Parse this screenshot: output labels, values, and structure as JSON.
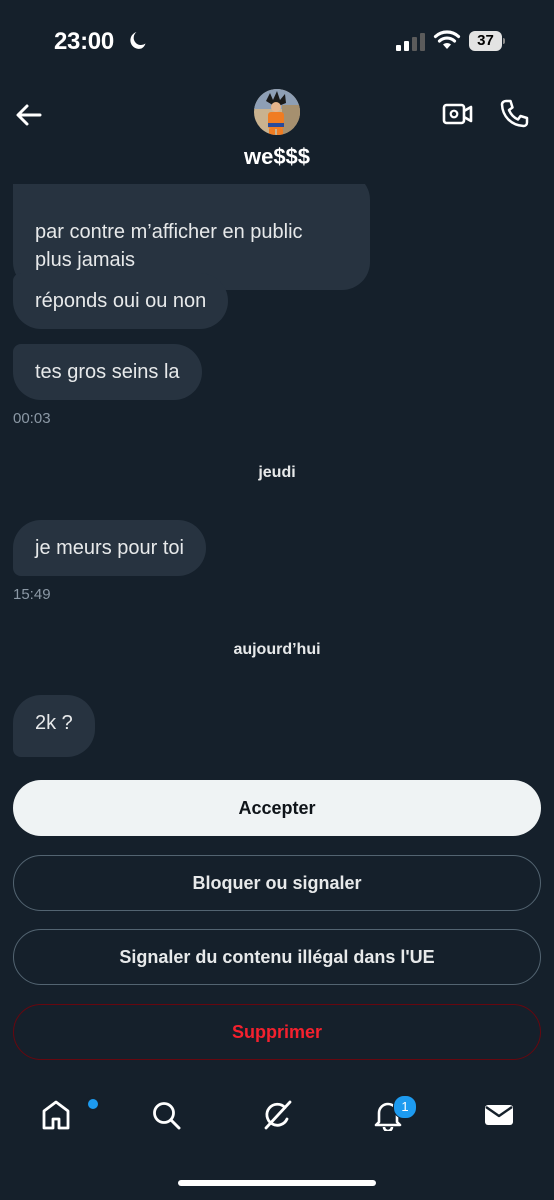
{
  "status_bar": {
    "time": "23:00",
    "battery": "37"
  },
  "header": {
    "name": "we$$$"
  },
  "messages": [
    {
      "text": "par contre m’afficher en public\nplus jamais"
    },
    {
      "text": "réponds oui ou non"
    },
    {
      "text": "tes gros seins la"
    }
  ],
  "timestamps": [
    "00:03",
    "15:49"
  ],
  "day_separators": [
    "jeudi",
    "aujourd’hui"
  ],
  "messages_thursday": [
    {
      "text": "je meurs pour toi"
    }
  ],
  "messages_today": [
    {
      "text": "2k ?"
    }
  ],
  "actions": {
    "accept": "Accepter",
    "block": "Bloquer ou signaler",
    "report_eu": "Signaler du contenu illégal dans l'UE",
    "delete": "Supprimer"
  },
  "tabbar": {
    "items": [
      {
        "icon": "home-icon"
      },
      {
        "icon": "search-icon"
      },
      {
        "icon": "grok-icon"
      },
      {
        "icon": "bell-icon",
        "badge": "1"
      },
      {
        "icon": "mail-icon"
      }
    ]
  },
  "colors": {
    "background": "#15202b",
    "bubble": "#273340",
    "accent": "#1d9bf0",
    "danger": "#f4212e"
  }
}
